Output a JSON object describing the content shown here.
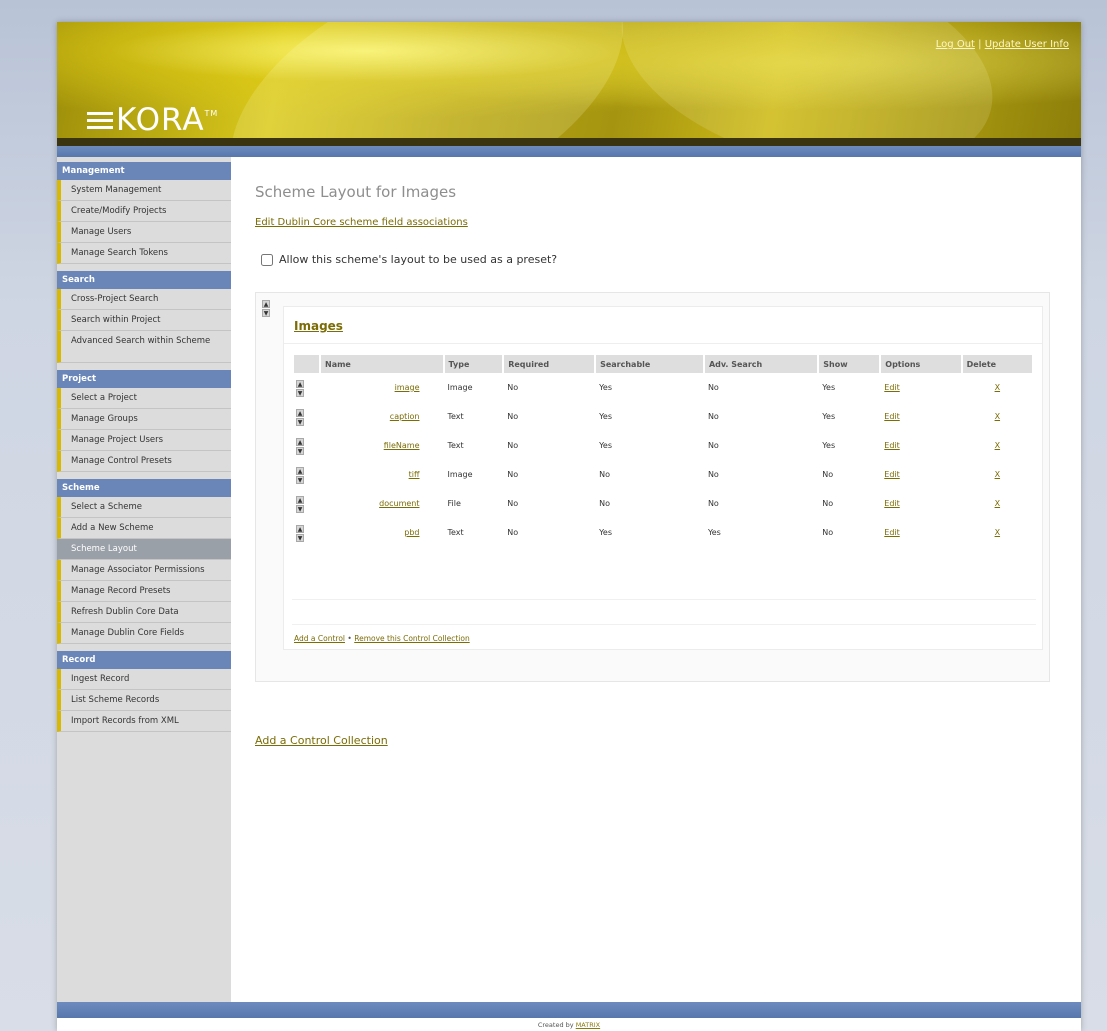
{
  "header": {
    "logo_text": "KORA",
    "logo_tm": "TM",
    "logout": "Log Out",
    "separator": "|",
    "update_user": "Update User Info"
  },
  "sidebar": {
    "sections": [
      {
        "title": "Management",
        "items": [
          "System Management",
          "Create/Modify Projects",
          "Manage Users",
          "Manage Search Tokens"
        ]
      },
      {
        "title": "Search",
        "items": [
          "Cross-Project Search",
          "Search within Project",
          "Advanced Search within Scheme"
        ]
      },
      {
        "title": "Project",
        "items": [
          "Select a Project",
          "Manage Groups",
          "Manage Project Users",
          "Manage Control Presets"
        ]
      },
      {
        "title": "Scheme",
        "items": [
          "Select a Scheme",
          "Add a New Scheme",
          "Scheme Layout",
          "Manage Associator Permissions",
          "Manage Record Presets",
          "Refresh Dublin Core Data",
          "Manage Dublin Core Fields"
        ]
      },
      {
        "title": "Record",
        "items": [
          "Ingest Record",
          "List Scheme Records",
          "Import Records from XML"
        ]
      }
    ],
    "active_item": "Scheme Layout"
  },
  "main": {
    "title": "Scheme Layout for Images",
    "dublin_core_link": "Edit Dublin Core scheme field associations",
    "preset_label": "Allow this scheme's layout to be used as a preset?",
    "preset_checked": false,
    "collection": {
      "name": "Images",
      "columns": [
        "Name",
        "Type",
        "Required",
        "Searchable",
        "Adv. Search",
        "Show",
        "Options",
        "Delete"
      ],
      "rows": [
        {
          "name": "image",
          "type": "Image",
          "required": "No",
          "searchable": "Yes",
          "adv": "No",
          "show": "Yes",
          "option": "Edit",
          "delete": "X"
        },
        {
          "name": "caption",
          "type": "Text",
          "required": "No",
          "searchable": "Yes",
          "adv": "No",
          "show": "Yes",
          "option": "Edit",
          "delete": "X"
        },
        {
          "name": "fileName",
          "type": "Text",
          "required": "No",
          "searchable": "Yes",
          "adv": "No",
          "show": "Yes",
          "option": "Edit",
          "delete": "X"
        },
        {
          "name": "tiff",
          "type": "Image",
          "required": "No",
          "searchable": "No",
          "adv": "No",
          "show": "No",
          "option": "Edit",
          "delete": "X"
        },
        {
          "name": "document",
          "type": "File",
          "required": "No",
          "searchable": "No",
          "adv": "No",
          "show": "No",
          "option": "Edit",
          "delete": "X"
        },
        {
          "name": "pbd",
          "type": "Text",
          "required": "No",
          "searchable": "Yes",
          "adv": "Yes",
          "show": "No",
          "option": "Edit",
          "delete": "X"
        }
      ],
      "add_control": "Add a Control",
      "footer_separator": "•",
      "remove_collection": "Remove this Control Collection"
    },
    "add_collection": "Add a Control Collection"
  },
  "footer": {
    "created_by": "Created by",
    "creator": "MATRIX"
  },
  "colors": {
    "header_gold": "#d9c81c",
    "nav_blue": "#6a86b8",
    "link": "#7b6c05",
    "sidebar_accent": "#d8b800"
  }
}
